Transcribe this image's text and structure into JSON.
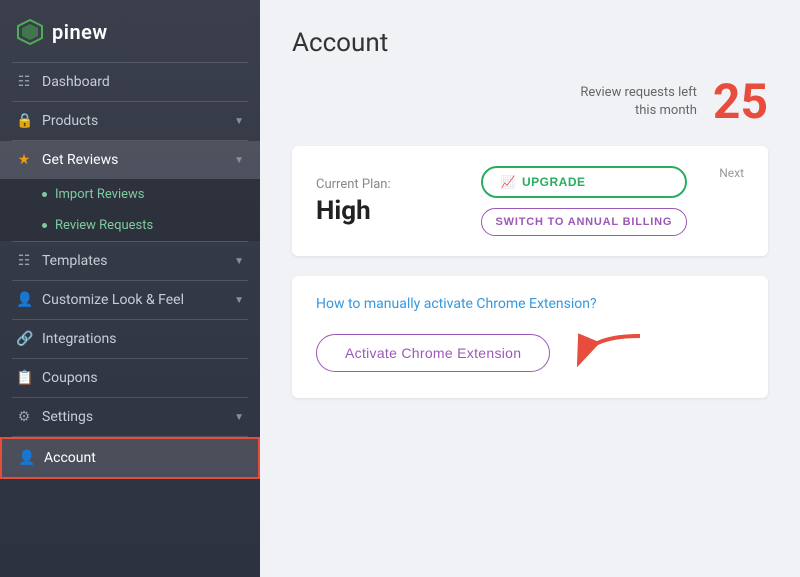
{
  "sidebar": {
    "logo": {
      "text": "pinew"
    },
    "items": [
      {
        "id": "dashboard",
        "label": "Dashboard",
        "icon": "📊"
      },
      {
        "id": "products",
        "label": "Products",
        "icon": "🔒",
        "hasChevron": true
      },
      {
        "id": "get-reviews",
        "label": "Get Reviews",
        "icon": "⭐",
        "hasChevron": true,
        "isActive": true
      },
      {
        "id": "templates",
        "label": "Templates",
        "icon": "📋",
        "hasChevron": true
      },
      {
        "id": "customize",
        "label": "Customize Look & Feel",
        "icon": "👤",
        "hasChevron": true
      },
      {
        "id": "integrations",
        "label": "Integrations",
        "icon": "🔗"
      },
      {
        "id": "coupons",
        "label": "Coupons",
        "icon": "🏷️"
      },
      {
        "id": "settings",
        "label": "Settings",
        "icon": "⚙️",
        "hasChevron": true
      },
      {
        "id": "account",
        "label": "Account",
        "icon": "👤",
        "isAccountActive": true
      }
    ],
    "subItems": [
      {
        "label": "Import Reviews"
      },
      {
        "label": "Review Requests"
      }
    ]
  },
  "main": {
    "page_title": "Account",
    "reviews_left_label": "Review requests left\nthis month",
    "reviews_count": "25",
    "current_plan_label": "Current Plan:",
    "plan_name": "High",
    "upgrade_btn": "UPGRADE",
    "switch_btn": "SWITCH TO ANNUAL BILLING",
    "next_label": "Next",
    "chrome_link": "How to manually activate Chrome Extension?",
    "chrome_btn": "Activate Chrome Extension"
  }
}
